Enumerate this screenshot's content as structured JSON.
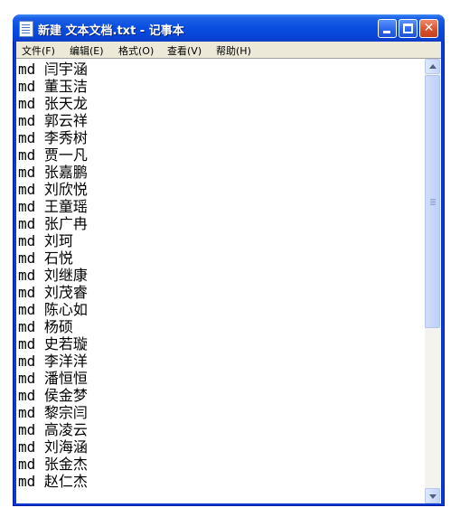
{
  "window": {
    "title": "新建 文本文档.txt - 记事本"
  },
  "menu": {
    "items": [
      "文件(F)",
      "编辑(E)",
      "格式(O)",
      "查看(V)",
      "帮助(H)"
    ]
  },
  "editor": {
    "lines": [
      "md 闫宇涵",
      "md 董玉洁",
      "md 张天龙",
      "md 郭云祥",
      "md 李秀树",
      "md 贾一凡",
      "md 张嘉鹏",
      "md 刘欣悦",
      "md 王童瑶",
      "md 张广冉",
      "md 刘珂",
      "md 石悦",
      "md 刘继康",
      "md 刘茂睿",
      "md 陈心如",
      "md 杨硕",
      "md 史若璇",
      "md 李洋洋",
      "md 潘恒恒",
      "md 侯金梦",
      "md 黎宗闫",
      "md 高凌云",
      "md 刘海涵",
      "md 张金杰",
      "md 赵仁杰"
    ]
  },
  "icons": {
    "app": "notepad-icon",
    "minimize": "minimize-icon",
    "maximize": "maximize-icon",
    "close": "close-icon",
    "scroll_up": "scroll-up-arrow-icon",
    "scroll_down": "scroll-down-arrow-icon"
  },
  "colors": {
    "titlebar": "#0a4fe0",
    "menubar": "#ece9d8",
    "close_button": "#d9532c",
    "text": "#000000"
  }
}
